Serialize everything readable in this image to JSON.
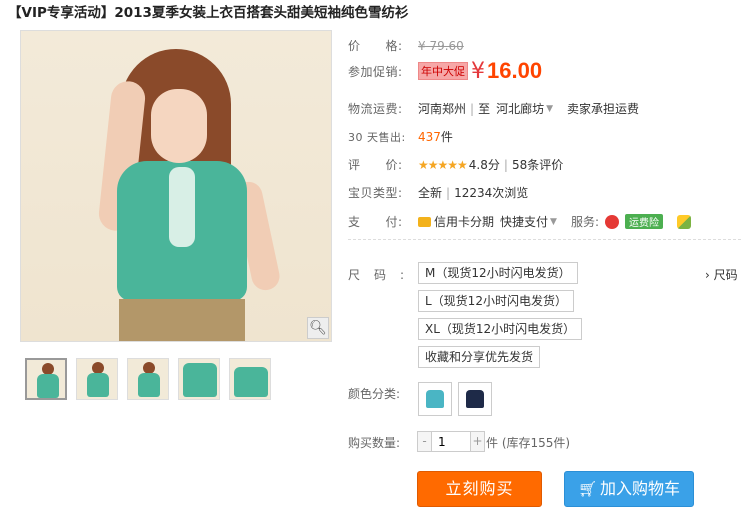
{
  "product": {
    "title": "【VIP专享活动】2013夏季女装上衣百搭套头甜美短袖纯色雪纺衫"
  },
  "gallery": {
    "zoom_icon": "magnifier-icon",
    "thumb_count": 5
  },
  "price": {
    "label": "价　　格:",
    "original": "¥ 79.60",
    "promo_label": "参加促销:",
    "promo_tag": "年中大促",
    "currency": "¥",
    "current": "16.00"
  },
  "shipping": {
    "label": "物流运费:",
    "from": "河南郑州",
    "to_prefix": "至",
    "to": "河北廊坊",
    "note": "卖家承担运费"
  },
  "sales": {
    "label": "30 天售出:",
    "count": "437",
    "unit": "件"
  },
  "rating": {
    "label": "评　　价:",
    "stars": "★★★★★",
    "score": "4.8分",
    "reviews": "58条评价"
  },
  "type": {
    "label": "宝贝类型:",
    "value": "全新",
    "views": "12234次浏览"
  },
  "payment": {
    "label": "支　　付:",
    "credit": "信用卡分期",
    "quick": "快捷支付",
    "service_label": "服务:",
    "freight_badge": "运费险"
  },
  "size": {
    "label": "尺码:",
    "options": [
      "M（现货12小时闪电发货）",
      "L（现货12小时闪电发货）",
      "XL（现货12小时闪电发货）",
      "收藏和分享优先发货"
    ],
    "chart_link": "› 尺码"
  },
  "color": {
    "label": "颜色分类:",
    "swatches": [
      "#4ab5c4",
      "#1e2a48"
    ]
  },
  "quantity": {
    "label": "购买数量:",
    "minus": "-",
    "value": "1",
    "plus": "+",
    "stock": "件 (库存155件)"
  },
  "actions": {
    "buy_now": "立刻购买",
    "add_cart": "加入购物车",
    "cart_icon": "cart-icon"
  },
  "colors": {
    "price": "#ff4400",
    "buy_button": "#ff6a00",
    "cart_button": "#3aa1e8",
    "accent": "#e4393c"
  }
}
